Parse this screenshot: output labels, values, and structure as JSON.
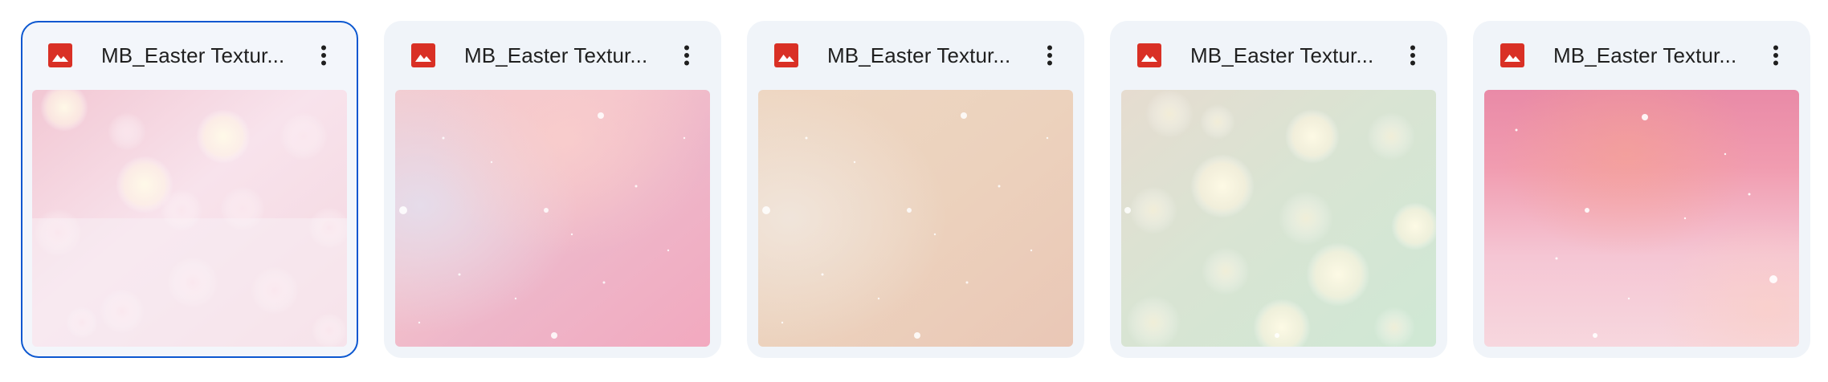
{
  "files": [
    {
      "name": "MB_Easter Textur...",
      "type_icon": "image-file-icon",
      "more_icon": "more-vert-icon",
      "thumbnail": "pink bokeh texture",
      "selected": true
    },
    {
      "name": "MB_Easter Textur...",
      "type_icon": "image-file-icon",
      "more_icon": "more-vert-icon",
      "thumbnail": "pink glitter texture",
      "selected": false
    },
    {
      "name": "MB_Easter Textur...",
      "type_icon": "image-file-icon",
      "more_icon": "more-vert-icon",
      "thumbnail": "beige glitter texture",
      "selected": false
    },
    {
      "name": "MB_Easter Textur...",
      "type_icon": "image-file-icon",
      "more_icon": "more-vert-icon",
      "thumbnail": "green bokeh texture",
      "selected": false
    },
    {
      "name": "MB_Easter Textur...",
      "type_icon": "image-file-icon",
      "more_icon": "more-vert-icon",
      "thumbnail": "pink sparkle texture",
      "selected": false
    }
  ],
  "colors": {
    "card_background": "#f0f4f9",
    "selected_border": "#0b57d0",
    "image_icon_red": "#d93025",
    "text": "#1f1f1f"
  }
}
